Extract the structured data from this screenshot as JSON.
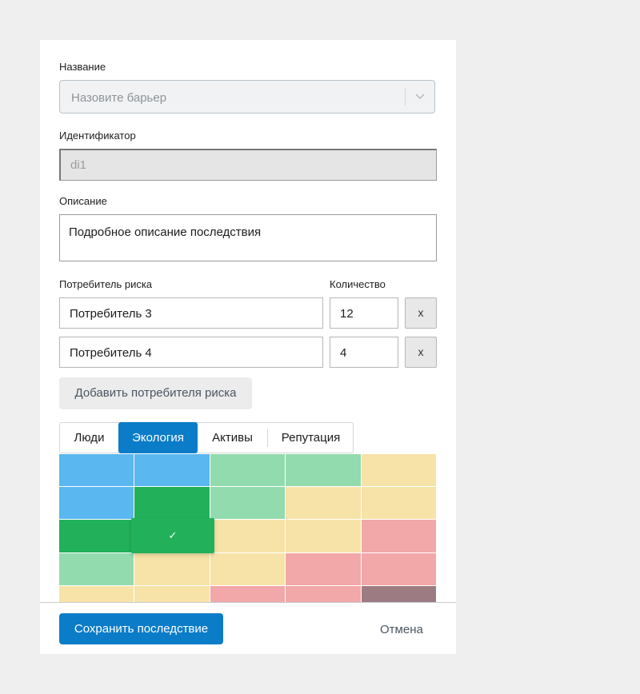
{
  "form": {
    "name_label": "Название",
    "name_placeholder": "Назовите барьер",
    "id_label": "Идентификатор",
    "id_value": "di1",
    "description_label": "Описание",
    "description_value": "Подробное описание последствия",
    "consumer_label": "Потребитель риска",
    "quantity_label": "Количество",
    "consumers": [
      {
        "name": "Потребитель 3",
        "quantity": "12",
        "remove_label": "x"
      },
      {
        "name": "Потребитель 4",
        "quantity": "4",
        "remove_label": "x"
      }
    ],
    "add_consumer_label": "Добавить потребителя риска"
  },
  "tabs": [
    {
      "label": "Люди",
      "active": false
    },
    {
      "label": "Экология",
      "active": true
    },
    {
      "label": "Активы",
      "active": false
    },
    {
      "label": "Репутация",
      "active": false
    }
  ],
  "matrix": {
    "colors": {
      "blue": "#5ab7f0",
      "green_dark": "#22b15a",
      "green_light": "#92dbae",
      "yellow": "#f7e3a7",
      "red": "#f2a7a8",
      "mauve": "#9c7c82"
    },
    "rows": [
      [
        "blue",
        "blue",
        "green_light",
        "green_light",
        "yellow"
      ],
      [
        "blue",
        "green_dark",
        "green_light",
        "yellow",
        "yellow"
      ],
      [
        "green_dark",
        "green_dark",
        "yellow",
        "yellow",
        "red"
      ],
      [
        "green_light",
        "yellow",
        "yellow",
        "red",
        "red"
      ],
      [
        "yellow",
        "yellow",
        "red",
        "red",
        "mauve"
      ]
    ],
    "selected": {
      "row": 2,
      "col": 1,
      "icon": "check-icon",
      "glyph": "✓"
    }
  },
  "footer": {
    "save_label": "Сохранить последствие",
    "cancel_label": "Отмена"
  },
  "accent_color": "#0b7cc8"
}
